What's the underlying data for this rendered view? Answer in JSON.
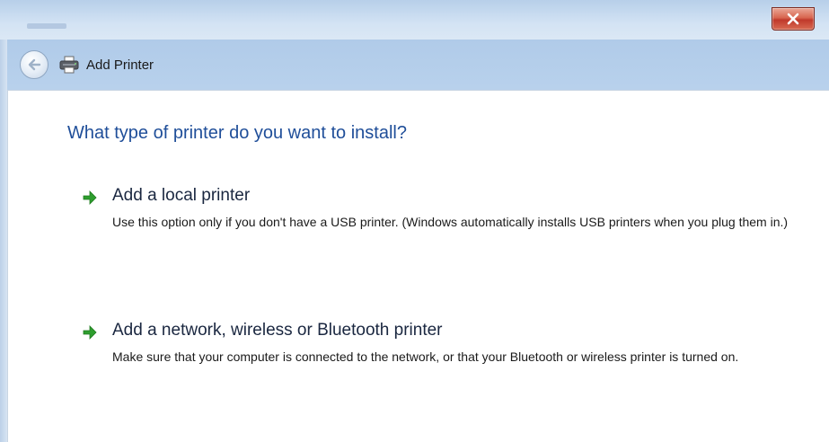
{
  "window": {
    "close_glyph": "x"
  },
  "nav": {
    "title": "Add Printer"
  },
  "main": {
    "heading": "What type of printer do you want to install?",
    "options": [
      {
        "title": "Add a local printer",
        "description": "Use this option only if you don't have a USB printer. (Windows automatically installs USB printers when you plug them in.)"
      },
      {
        "title": "Add a network, wireless or Bluetooth printer",
        "description": "Make sure that your computer is connected to the network, or that your Bluetooth or wireless printer is turned on."
      }
    ]
  },
  "colors": {
    "heading": "#1f4e99",
    "arrow": "#2e9e2e",
    "close": "#c0392b"
  },
  "icons": {
    "back": "back-arrow-icon",
    "printer": "printer-icon",
    "option_arrow": "green-arrow-icon",
    "close": "close-icon"
  }
}
